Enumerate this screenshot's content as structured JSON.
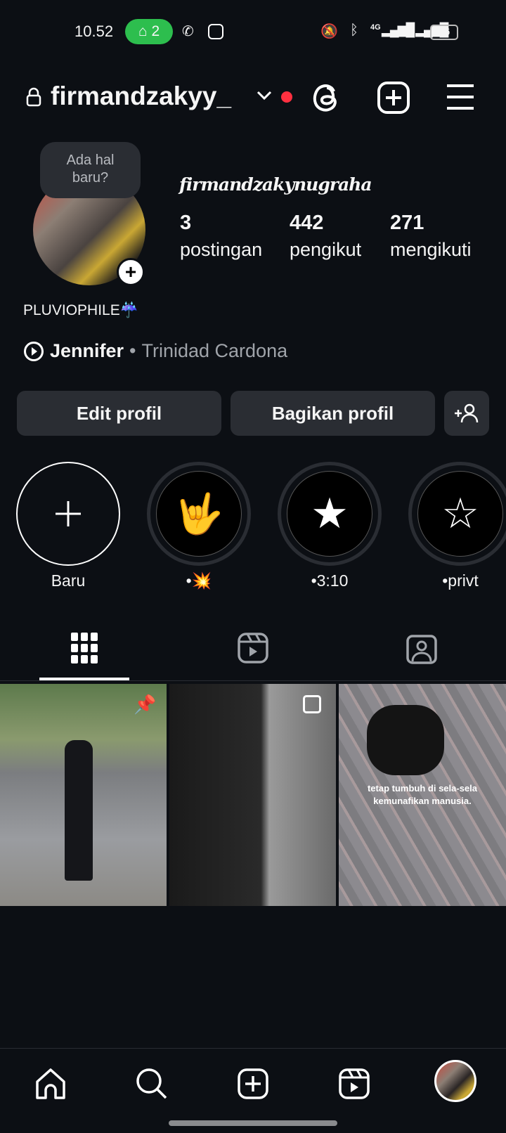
{
  "status_bar": {
    "time": "10.52",
    "hotspot_count": "2",
    "battery": "46",
    "network": "4G"
  },
  "header": {
    "username": "firmandzakyy_"
  },
  "tooltip": {
    "text_line1": "Ada hal",
    "text_line2": "baru?"
  },
  "profile": {
    "display_name": "firmandzakynugraha",
    "bio": "PLUVIOPHILE☔",
    "music_title": "Jennifer",
    "music_artist": "Trinidad Cardona",
    "music_sep": "•",
    "stats": [
      {
        "value": "3",
        "label": "postingan"
      },
      {
        "value": "442",
        "label": "pengikut"
      },
      {
        "value": "271",
        "label": "mengikuti"
      }
    ]
  },
  "buttons": {
    "edit": "Edit profil",
    "share": "Bagikan profil"
  },
  "highlights": [
    {
      "label": "Baru"
    },
    {
      "label": "•💥"
    },
    {
      "label": "•3:10"
    },
    {
      "label": "•privt"
    }
  ],
  "posts": [
    {
      "caption": ""
    },
    {
      "caption": ""
    },
    {
      "caption": "tetap tumbuh di sela-sela kemunafikan manusia."
    }
  ],
  "colors": {
    "background": "#0c0f14",
    "button": "#2a2d33",
    "hotspot": "#2dbe4e",
    "notification_dot": "#ff3040"
  }
}
